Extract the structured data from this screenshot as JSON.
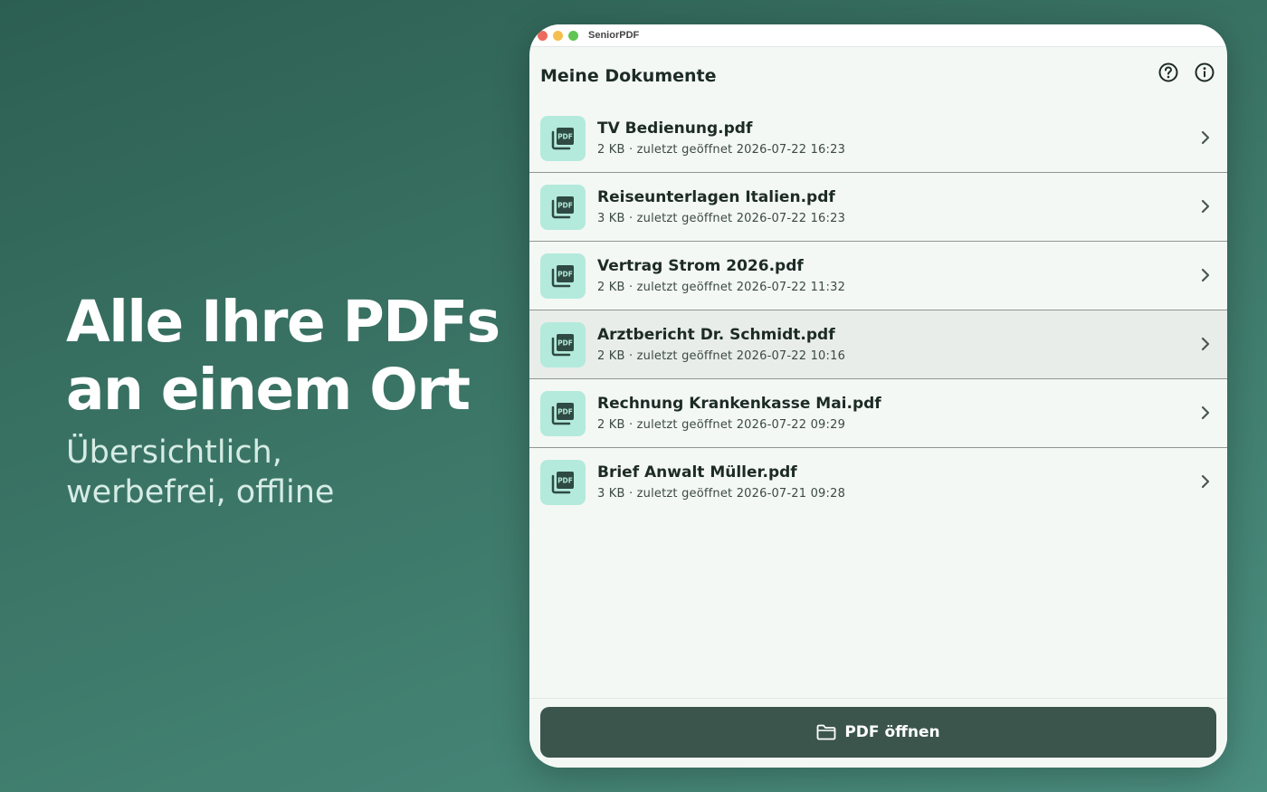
{
  "promo": {
    "headline_line1": "Alle Ihre PDFs",
    "headline_line2": "an einem Ort",
    "subline_line1": "Übersichtlich,",
    "subline_line2": "werbefrei, offline"
  },
  "window": {
    "app_title": "SeniorPDF",
    "page_title": "Meine Dokumente",
    "icons": [
      "help-icon",
      "info-icon"
    ]
  },
  "documents": [
    {
      "name": "TV Bedienung.pdf",
      "meta": "2 KB · zuletzt geöffnet 2026-07-22 16:23"
    },
    {
      "name": "Reiseunterlagen Italien.pdf",
      "meta": "3 KB · zuletzt geöffnet 2026-07-22 16:23"
    },
    {
      "name": "Vertrag Strom 2026.pdf",
      "meta": "2 KB · zuletzt geöffnet 2026-07-22 11:32"
    },
    {
      "name": "Arztbericht Dr. Schmidt.pdf",
      "meta": "2 KB · zuletzt geöffnet 2026-07-22 10:16"
    },
    {
      "name": "Rechnung Krankenkasse Mai.pdf",
      "meta": "2 KB · zuletzt geöffnet 2026-07-22 09:29"
    },
    {
      "name": "Brief Anwalt Müller.pdf",
      "meta": "3 KB · zuletzt geöffnet 2026-07-21 09:28"
    }
  ],
  "pdf_badge": "PDF",
  "footer": {
    "open_label": "PDF öffnen",
    "icon": "folder-icon"
  },
  "colors": {
    "accent": "#3b554d",
    "thumb": "#b3eadb",
    "background": "#3b7566"
  }
}
